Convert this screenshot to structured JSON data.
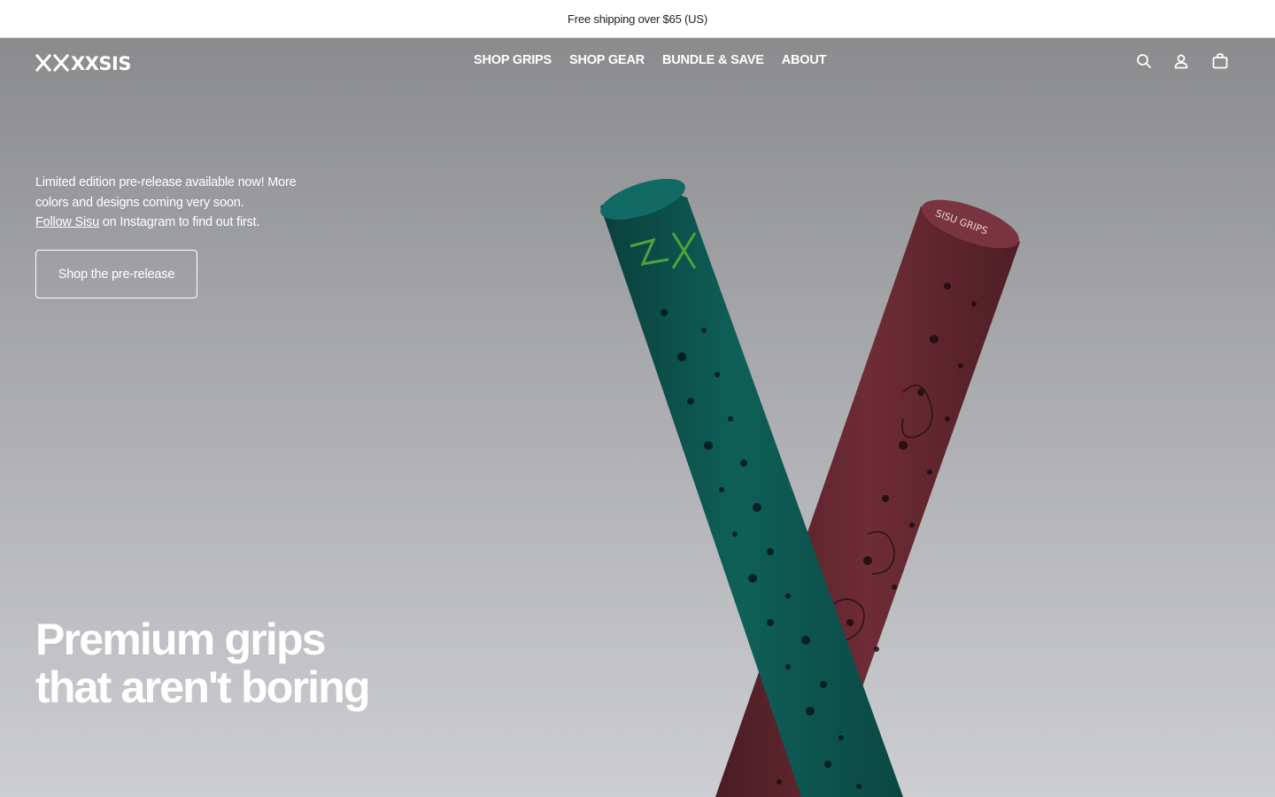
{
  "announcement": {
    "text": "Free shipping over $65 (US)"
  },
  "header": {
    "logo_text": "XXSISU",
    "nav": [
      {
        "label": "SHOP GRIPS"
      },
      {
        "label": "SHOP GEAR"
      },
      {
        "label": "BUNDLE & SAVE"
      },
      {
        "label": "ABOUT"
      }
    ],
    "icons": [
      "search-icon",
      "account-icon",
      "cart-icon"
    ]
  },
  "hero": {
    "promo_line1": "Limited edition pre-release available now! More colors and designs coming very soon.",
    "promo_link": "Follow Sisu",
    "promo_line2": " on Instagram to find out first.",
    "cta_label": "Shop the pre-release",
    "headline_line1": "Premium grips",
    "headline_line2": "that aren't boring",
    "grip_cap_text": "SISU GRIPS",
    "colors": {
      "teal_grip": "#0e5a55",
      "maroon_grip": "#6a2a34",
      "logo_green": "#4fa33a",
      "background_top": "#8a8b8d",
      "background_bottom": "#cdced2"
    }
  }
}
